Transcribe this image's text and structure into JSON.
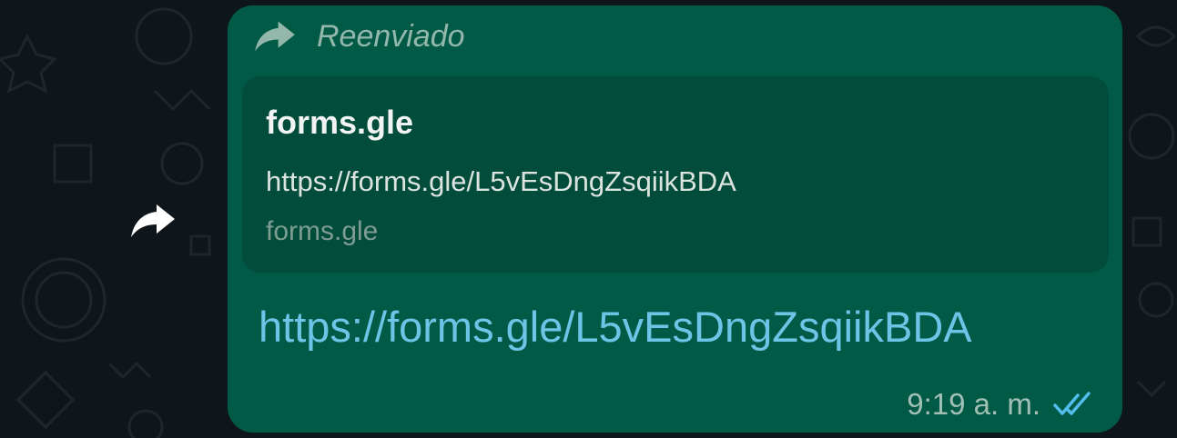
{
  "message": {
    "forwarded_label": "Reenviado",
    "preview": {
      "title": "forms.gle",
      "description": "https://forms.gle/L5vEsDngZsqiikBDA",
      "domain": "forms.gle"
    },
    "link_text": "https://forms.gle/L5vEsDngZsqiikBDA",
    "timestamp": "9:19 a. m.",
    "status": "read"
  },
  "icons": {
    "forwarded": "forward-arrow-icon",
    "share": "share-arrow-icon",
    "read_receipt": "double-check-icon"
  },
  "colors": {
    "bubble": "#015a45",
    "preview": "#024c3b",
    "link": "#6dc4e6",
    "read_receipt": "#53bdeb",
    "chat_background": "#0f161b"
  }
}
